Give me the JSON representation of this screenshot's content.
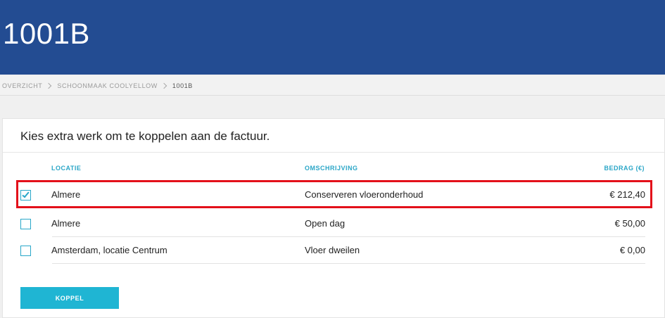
{
  "header": {
    "title": "1001B"
  },
  "breadcrumb": [
    {
      "label": "OVERZICHT"
    },
    {
      "label": "SCHOONMAAK COOLYELLOW"
    },
    {
      "label": "1001B"
    }
  ],
  "card": {
    "title": "Kies extra werk om te koppelen aan de factuur.",
    "columns": {
      "location": "LOCATIE",
      "description": "OMSCHRIJVING",
      "amount": "BEDRAG (€)"
    },
    "rows": [
      {
        "checked": true,
        "location": "Almere",
        "description": "Conserveren vloeronderhoud",
        "amount": "€ 212,40"
      },
      {
        "checked": false,
        "location": "Almere",
        "description": "Open dag",
        "amount": "€ 50,00"
      },
      {
        "checked": false,
        "location": "Amsterdam, locatie Centrum",
        "description": "Vloer dweilen",
        "amount": "€ 0,00"
      }
    ],
    "button_label": "KOPPEL"
  },
  "colors": {
    "header_bg": "#234c92",
    "accent": "#1fb5d3",
    "highlight": "#e3101a"
  }
}
